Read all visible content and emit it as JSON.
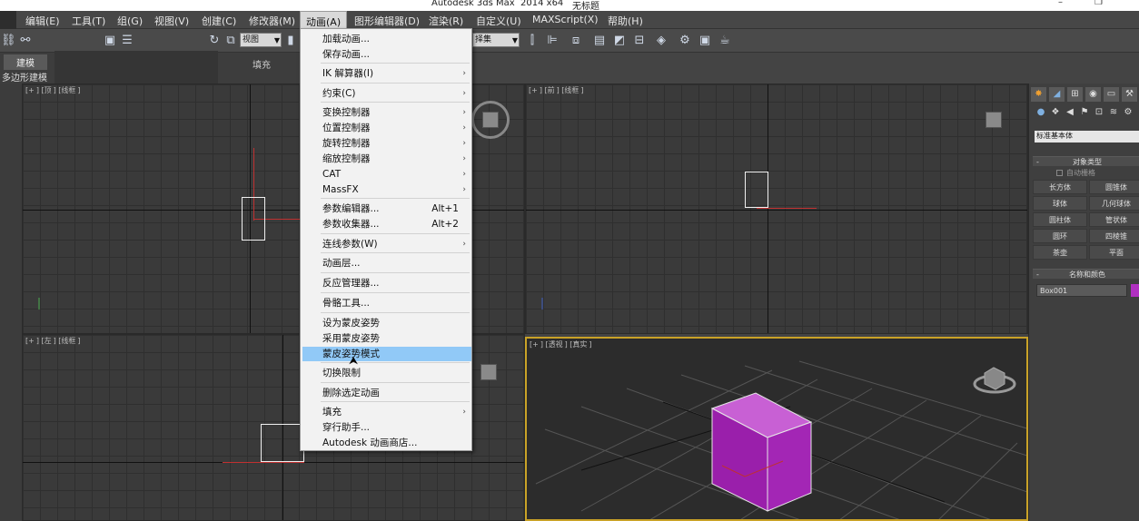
{
  "window": {
    "title": "Autodesk 3ds Max  2014 x64",
    "doc_name": "无标题",
    "minimize": "–",
    "restore": "❐"
  },
  "menubar": {
    "items": [
      "编辑(E)",
      "工具(T)",
      "组(G)",
      "视图(V)",
      "创建(C)",
      "修改器(M)",
      "动画(A)",
      "图形编辑器(D)",
      "渲染(R)",
      "自定义(U)",
      "MAXScript(X)",
      "帮助(H)"
    ],
    "active_index": 6
  },
  "toolbar": {
    "view_select": "视图",
    "named_sel": "择集"
  },
  "ribbon": {
    "tab_model": "建模",
    "tab_fill": "填充",
    "poly_label": "多边形建模"
  },
  "viewports": {
    "top": [
      "+",
      "顶",
      "线框"
    ],
    "front": [
      "+",
      "前",
      "线框"
    ],
    "left": [
      "+",
      "左",
      "线框"
    ],
    "persp": [
      "+",
      "透视",
      "真实"
    ]
  },
  "anim_menu": {
    "items": [
      {
        "label": "加载动画...",
        "shortcut": "",
        "sub": false
      },
      {
        "label": "保存动画...",
        "shortcut": "",
        "sub": false
      },
      {
        "label": "IK 解算器(I)",
        "shortcut": "",
        "sub": true
      },
      {
        "label": "约束(C)",
        "shortcut": "",
        "sub": true
      },
      {
        "label": "变换控制器",
        "shortcut": "",
        "sub": true
      },
      {
        "label": "位置控制器",
        "shortcut": "",
        "sub": true
      },
      {
        "label": "旋转控制器",
        "shortcut": "",
        "sub": true
      },
      {
        "label": "缩放控制器",
        "shortcut": "",
        "sub": true
      },
      {
        "label": "CAT",
        "shortcut": "",
        "sub": true
      },
      {
        "label": "MassFX",
        "shortcut": "",
        "sub": true
      },
      {
        "label": "参数编辑器...",
        "shortcut": "Alt+1",
        "sub": false
      },
      {
        "label": "参数收集器...",
        "shortcut": "Alt+2",
        "sub": false
      },
      {
        "label": "连线参数(W)",
        "shortcut": "",
        "sub": true
      },
      {
        "label": "动画层...",
        "shortcut": "",
        "sub": false
      },
      {
        "label": "反应管理器...",
        "shortcut": "",
        "sub": false
      },
      {
        "label": "骨骼工具...",
        "shortcut": "",
        "sub": false
      },
      {
        "label": "设为蒙皮姿势",
        "shortcut": "",
        "sub": false
      },
      {
        "label": "采用蒙皮姿势",
        "shortcut": "",
        "sub": false
      },
      {
        "label": "蒙皮姿势模式",
        "shortcut": "",
        "sub": false
      },
      {
        "label": "切换限制",
        "shortcut": "",
        "sub": false
      },
      {
        "label": "删除选定动画",
        "shortcut": "",
        "sub": false
      },
      {
        "label": "填充",
        "shortcut": "",
        "sub": true
      },
      {
        "label": "穿行助手...",
        "shortcut": "",
        "sub": false
      },
      {
        "label": "Autodesk 动画商店...",
        "shortcut": "",
        "sub": false
      }
    ],
    "highlighted_index": 18
  },
  "command_panel": {
    "dropdown": "标准基本体",
    "object_type_title": "对象类型",
    "auto_grid": "自动栅格",
    "buttons": [
      "长方体",
      "圆锥体",
      "球体",
      "几何球体",
      "圆柱体",
      "管状体",
      "圆环",
      "四棱锥",
      "茶壶",
      "平面"
    ],
    "name_color_title": "名称和颜色",
    "object_name": "Box001",
    "rollout_minus": "-"
  },
  "colors": {
    "box": "#b030c0",
    "highlight": "#91c9f7",
    "active_border": "#c9a227"
  }
}
